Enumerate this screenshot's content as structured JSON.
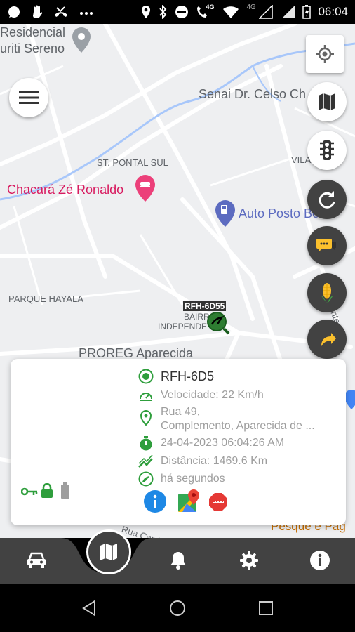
{
  "status_bar": {
    "network": "4G",
    "net_small": "4G",
    "time": "06:04"
  },
  "map": {
    "labels": {
      "residencial_1": "Residencial",
      "residencial_2": "uriti Sereno",
      "senai": "Senai Dr. Celso Ch",
      "st_pontal": "ST. PONTAL SUL",
      "vila": "VILA",
      "chacara": "Chacará Zé Ronaldo",
      "auto_posto": "Auto Posto Box",
      "parque": "PARQUE HAYALA",
      "bairro_1": "BAIRRO",
      "bairro_2": "INDEPENDE",
      "proreg": "PROREG Aparecida",
      "pesque": "Pesque e Pag",
      "rua_car": "Rua Card",
      "ante": "ante"
    },
    "vehicle_tag": "RFH-6D55",
    "fab_icons": [
      "map-icon",
      "traffic-light-icon",
      "refresh-icon",
      "chat-icon",
      "corn-icon",
      "share-arrow-icon"
    ]
  },
  "vehicle_card": {
    "plate": "RFH-6D5",
    "speed": "Velocidade: 22 Km/h",
    "address_line1": "Rua 49,",
    "address_line2": "Complemento, Aparecida de ...",
    "datetime": "24-04-2023 06:04:26 AM",
    "distance": "Distância: 1469.6 Km",
    "last_update": "há segundos",
    "actions": [
      "info-icon",
      "google-maps-icon",
      "stop-icon"
    ],
    "status_icons": [
      "key-icon",
      "lock-icon",
      "battery-icon"
    ],
    "colors": {
      "green": "#2e9e3c",
      "blue": "#1e88e5",
      "red": "#e53935"
    }
  },
  "bottom_nav": {
    "items": [
      "car-icon",
      "map-icon",
      "bell-icon",
      "gear-icon",
      "info-icon"
    ],
    "active": "map-icon"
  }
}
